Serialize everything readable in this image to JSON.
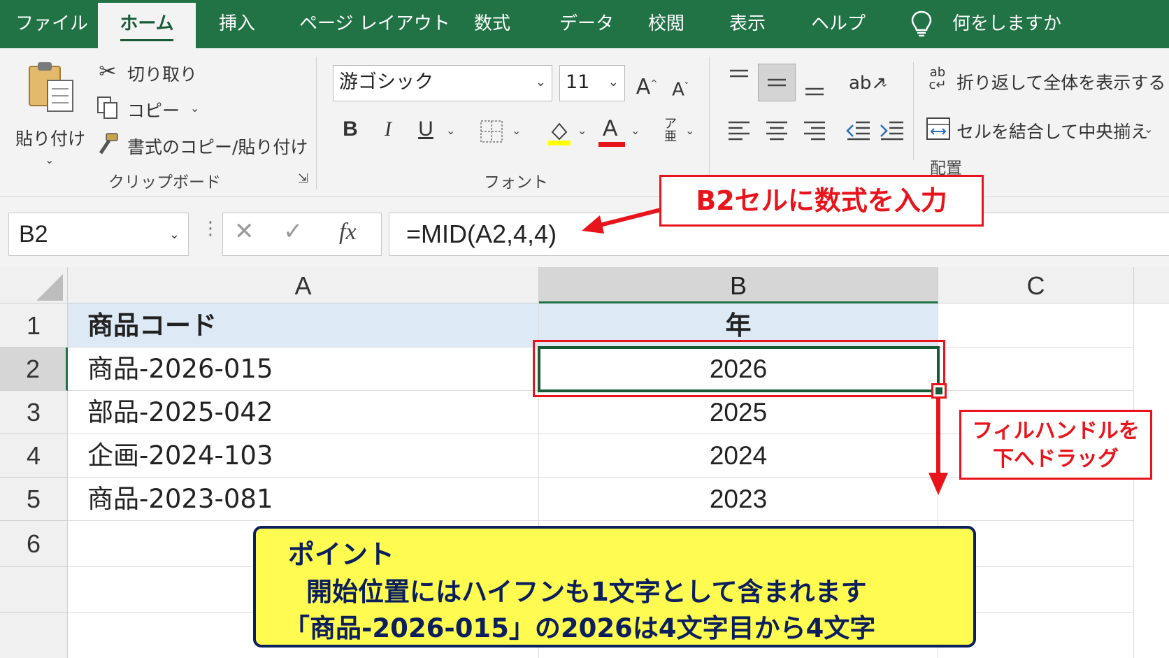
{
  "ribbon_tabs": [
    "ファイル",
    "ホーム",
    "挿入",
    "ページ レイアウト",
    "数式",
    "データ",
    "校閲",
    "表示",
    "ヘルプ"
  ],
  "active_tab": "ホーム",
  "tell_me": "何をしますか",
  "clipboard": {
    "paste": "貼り付け",
    "cut": "切り取り",
    "copy": "コピー",
    "format_painter": "書式のコピー/貼り付け",
    "group_label": "クリップボード"
  },
  "font": {
    "name": "游ゴシック",
    "size": "11",
    "bold": "B",
    "italic": "I",
    "underline": "U",
    "group_label": "フォント"
  },
  "alignment": {
    "wrap_text": "折り返して全体を表示する",
    "merge_center": "セルを結合して中央揃え",
    "group_label": "配置"
  },
  "formula_bar": {
    "name_box": "B2",
    "fx": "fx",
    "formula": "=MID(A2,4,4)"
  },
  "columns": [
    "A",
    "B",
    "C"
  ],
  "selected_column": "B",
  "rows": [
    {
      "num": "1",
      "a": "商品コード",
      "b": "年"
    },
    {
      "num": "2",
      "a": "商品-2026-015",
      "b": "2026"
    },
    {
      "num": "3",
      "a": "部品-2025-042",
      "b": "2025"
    },
    {
      "num": "4",
      "a": "企画-2024-103",
      "b": "2024"
    },
    {
      "num": "5",
      "a": "商品-2023-081",
      "b": "2023"
    },
    {
      "num": "6",
      "a": "",
      "b": ""
    }
  ],
  "selected_cell": "B2",
  "annotations": {
    "formula_callout": "B2セルに数式を入力",
    "fill_handle_callout_1": "フィルハンドルを",
    "fill_handle_callout_2": "下へドラッグ",
    "point_title": "ポイント",
    "point_line_1": "開始位置にはハイフンも1文字として含まれます",
    "point_line_2": "「商品-2026-015」の2026は4文字目から4文字"
  },
  "colors": {
    "excel_green": "#217346",
    "callout_red": "#e8141b",
    "point_yellow": "#fffb50",
    "point_navy": "#0b1f5c",
    "header_fill": "#dde9f5"
  }
}
